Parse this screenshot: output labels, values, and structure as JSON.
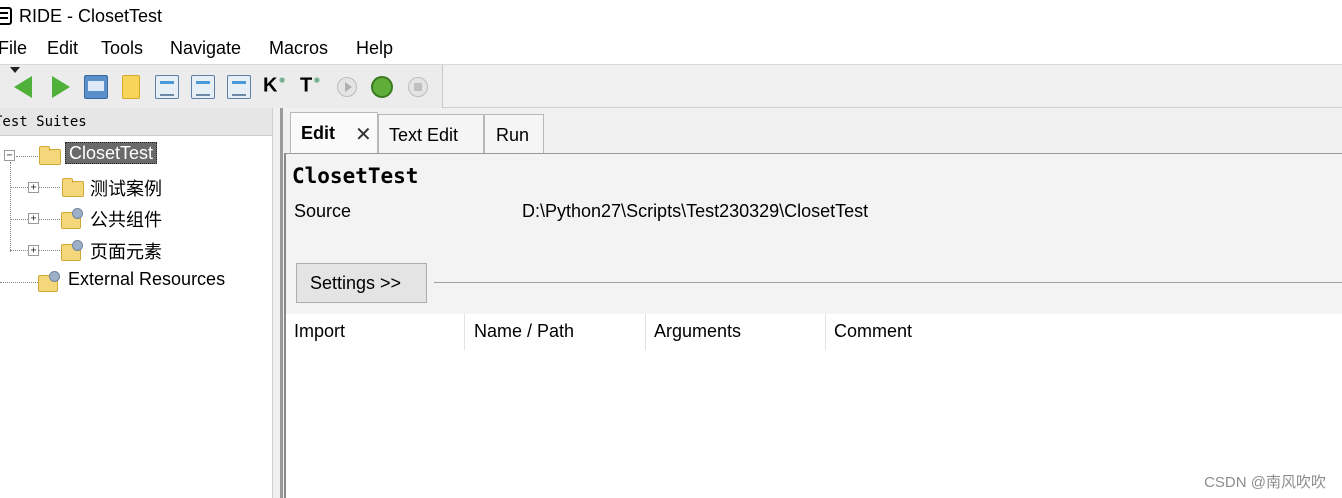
{
  "window": {
    "title": "RIDE - ClosetTest"
  },
  "menubar": {
    "items": [
      "File",
      "Edit",
      "Tools",
      "Navigate",
      "Macros",
      "Help"
    ]
  },
  "toolbar": {
    "buttons": [
      "back-icon",
      "forward-icon",
      "open-icon",
      "new-icon",
      "save-icon",
      "save-all-icon",
      "save-as-icon",
      "search-keywords-icon",
      "search-tests-icon",
      "run-icon",
      "debug-icon",
      "stop-icon"
    ],
    "text_buttons": {
      "keyword": "K",
      "test": "T"
    }
  },
  "tree": {
    "header": "Test Suites",
    "root": "ClosetTest",
    "children": [
      "测试案例",
      "公共组件",
      "页面元素"
    ],
    "external": "External Resources",
    "expander_symbol": "+",
    "collapse_symbol": "−"
  },
  "tabs": [
    {
      "label": "Edit",
      "active": true,
      "close": "✕"
    },
    {
      "label": "Text Edit",
      "active": false
    },
    {
      "label": "Run",
      "active": false
    }
  ],
  "editor": {
    "suite_name": "ClosetTest",
    "source_label": "Source",
    "source_value": "D:\\Python27\\Scripts\\Test230329\\ClosetTest",
    "settings_button": "Settings >>",
    "columns": [
      "Import",
      "Name / Path",
      "Arguments",
      "Comment"
    ]
  },
  "watermark": "CSDN @南风吹吹",
  "colors": {
    "selection_bg": "#6a6a6a",
    "toolbar_bg": "#f0f0f0",
    "accent_green": "#4fb03a"
  }
}
